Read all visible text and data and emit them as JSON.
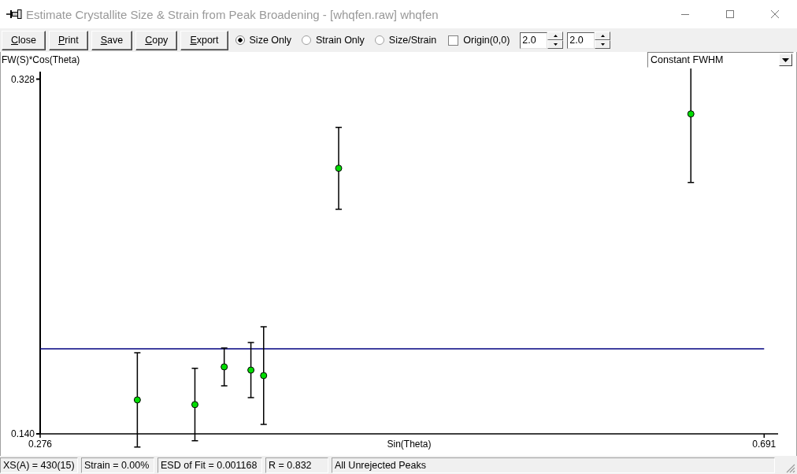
{
  "window": {
    "title": "Estimate Crystallite Size & Strain from Peak Broadening - [whqfen.raw] whqfen"
  },
  "toolbar": {
    "buttons": [
      "Close",
      "Print",
      "Save",
      "Copy",
      "Export"
    ],
    "modes": [
      {
        "label": "Size Only",
        "selected": true
      },
      {
        "label": "Strain Only",
        "selected": false
      },
      {
        "label": "Size/Strain",
        "selected": false
      }
    ],
    "origin": {
      "label": "Origin(0,0)",
      "checked": false
    },
    "spinners": [
      {
        "value": "2.0"
      },
      {
        "value": "2.0"
      }
    ]
  },
  "plot": {
    "dropdown": {
      "value": "Constant FWHM"
    },
    "chart_data": {
      "type": "scatter",
      "xlabel": "Sin(Theta)",
      "ylabel": "FW(S)*Cos(Theta)",
      "x": [
        0.3317,
        0.3647,
        0.3815,
        0.3968,
        0.4041,
        0.4471,
        0.649
      ],
      "series": [
        {
          "color": "#00dd00",
          "values": [
            0.158,
            0.1555,
            0.1755,
            0.1738,
            0.1709,
            0.2808,
            0.3096
          ],
          "errors": [
            0.025,
            0.0192,
            0.01,
            0.0146,
            0.0259,
            0.0217,
            [
              0.2733,
              0.3337
            ]
          ]
        }
      ],
      "xlim": [
        0.276,
        0.699
      ],
      "ylim": [
        0.14,
        0.332
      ],
      "xticks": [
        {
          "value": 0.276,
          "label": "0.276"
        },
        {
          "value": 0.691,
          "label": "0.691"
        }
      ],
      "yticks": [
        {
          "value": 0.14,
          "label": "0.140"
        },
        {
          "value": 0.328,
          "label": "0.328"
        }
      ],
      "ref_lines": [
        {
          "axis": "y",
          "value": 0.1851
        }
      ]
    }
  },
  "status_bar": [
    "XS(A) = 430(15)",
    "Strain = 0.00%",
    "ESD of Fit = 0.001168",
    "R = 0.832",
    "All Unrejected Peaks"
  ]
}
